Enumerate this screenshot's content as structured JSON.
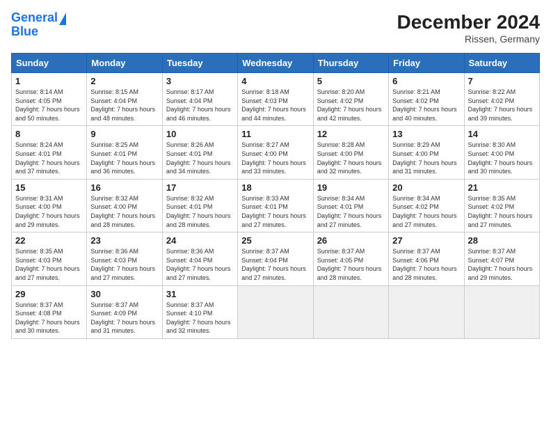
{
  "header": {
    "logo_line1": "General",
    "logo_line2": "Blue",
    "title": "December 2024",
    "subtitle": "Rissen, Germany"
  },
  "calendar": {
    "days_of_week": [
      "Sunday",
      "Monday",
      "Tuesday",
      "Wednesday",
      "Thursday",
      "Friday",
      "Saturday"
    ],
    "weeks": [
      [
        null,
        {
          "day": 2,
          "rise": "8:15 AM",
          "set": "4:04 PM",
          "daylight": "7 hours and 48 minutes."
        },
        {
          "day": 3,
          "rise": "8:17 AM",
          "set": "4:04 PM",
          "daylight": "7 hours and 46 minutes."
        },
        {
          "day": 4,
          "rise": "8:18 AM",
          "set": "4:03 PM",
          "daylight": "7 hours and 44 minutes."
        },
        {
          "day": 5,
          "rise": "8:20 AM",
          "set": "4:02 PM",
          "daylight": "7 hours and 42 minutes."
        },
        {
          "day": 6,
          "rise": "8:21 AM",
          "set": "4:02 PM",
          "daylight": "7 hours and 40 minutes."
        },
        {
          "day": 7,
          "rise": "8:22 AM",
          "set": "4:02 PM",
          "daylight": "7 hours and 39 minutes."
        }
      ],
      [
        {
          "day": 1,
          "rise": "8:14 AM",
          "set": "4:05 PM",
          "daylight": "7 hours and 50 minutes."
        },
        {
          "day": 8,
          "rise": "8:24 AM",
          "set": "4:01 PM",
          "daylight": "7 hours and 37 minutes."
        },
        {
          "day": 9,
          "rise": "8:25 AM",
          "set": "4:01 PM",
          "daylight": "7 hours and 36 minutes."
        },
        {
          "day": 10,
          "rise": "8:26 AM",
          "set": "4:01 PM",
          "daylight": "7 hours and 34 minutes."
        },
        {
          "day": 11,
          "rise": "8:27 AM",
          "set": "4:00 PM",
          "daylight": "7 hours and 33 minutes."
        },
        {
          "day": 12,
          "rise": "8:28 AM",
          "set": "4:00 PM",
          "daylight": "7 hours and 32 minutes."
        },
        {
          "day": 13,
          "rise": "8:29 AM",
          "set": "4:00 PM",
          "daylight": "7 hours and 31 minutes."
        },
        {
          "day": 14,
          "rise": "8:30 AM",
          "set": "4:00 PM",
          "daylight": "7 hours and 30 minutes."
        }
      ],
      [
        {
          "day": 15,
          "rise": "8:31 AM",
          "set": "4:00 PM",
          "daylight": "7 hours and 29 minutes."
        },
        {
          "day": 16,
          "rise": "8:32 AM",
          "set": "4:00 PM",
          "daylight": "7 hours and 28 minutes."
        },
        {
          "day": 17,
          "rise": "8:32 AM",
          "set": "4:01 PM",
          "daylight": "7 hours and 28 minutes."
        },
        {
          "day": 18,
          "rise": "8:33 AM",
          "set": "4:01 PM",
          "daylight": "7 hours and 27 minutes."
        },
        {
          "day": 19,
          "rise": "8:34 AM",
          "set": "4:01 PM",
          "daylight": "7 hours and 27 minutes."
        },
        {
          "day": 20,
          "rise": "8:34 AM",
          "set": "4:02 PM",
          "daylight": "7 hours and 27 minutes."
        },
        {
          "day": 21,
          "rise": "8:35 AM",
          "set": "4:02 PM",
          "daylight": "7 hours and 27 minutes."
        }
      ],
      [
        {
          "day": 22,
          "rise": "8:35 AM",
          "set": "4:03 PM",
          "daylight": "7 hours and 27 minutes."
        },
        {
          "day": 23,
          "rise": "8:36 AM",
          "set": "4:03 PM",
          "daylight": "7 hours and 27 minutes."
        },
        {
          "day": 24,
          "rise": "8:36 AM",
          "set": "4:04 PM",
          "daylight": "7 hours and 27 minutes."
        },
        {
          "day": 25,
          "rise": "8:37 AM",
          "set": "4:04 PM",
          "daylight": "7 hours and 27 minutes."
        },
        {
          "day": 26,
          "rise": "8:37 AM",
          "set": "4:05 PM",
          "daylight": "7 hours and 28 minutes."
        },
        {
          "day": 27,
          "rise": "8:37 AM",
          "set": "4:06 PM",
          "daylight": "7 hours and 28 minutes."
        },
        {
          "day": 28,
          "rise": "8:37 AM",
          "set": "4:07 PM",
          "daylight": "7 hours and 29 minutes."
        }
      ],
      [
        {
          "day": 29,
          "rise": "8:37 AM",
          "set": "4:08 PM",
          "daylight": "7 hours and 30 minutes."
        },
        {
          "day": 30,
          "rise": "8:37 AM",
          "set": "4:09 PM",
          "daylight": "7 hours and 31 minutes."
        },
        {
          "day": 31,
          "rise": "8:37 AM",
          "set": "4:10 PM",
          "daylight": "7 hours and 32 minutes."
        },
        null,
        null,
        null,
        null
      ]
    ]
  }
}
